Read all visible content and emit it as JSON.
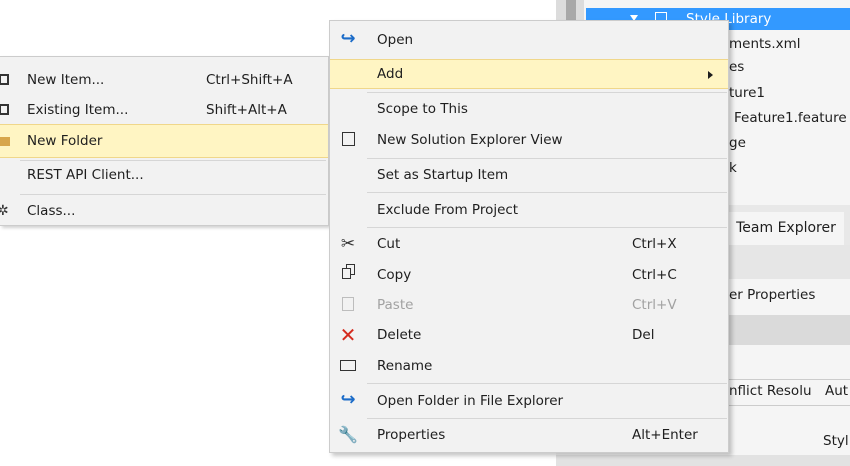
{
  "background": {
    "tree_items": [
      {
        "label": "Style Library",
        "selected": true
      },
      {
        "label": "ments.xml"
      },
      {
        "label": "es"
      },
      {
        "label": "ture1"
      },
      {
        "label": "Feature1.feature"
      },
      {
        "label": "ge"
      },
      {
        "label": "k"
      }
    ],
    "active_tab": "Team Explorer",
    "properties_title": "er Properties",
    "conflict_row_label": "nflict Resolu",
    "conflict_row_value": "Aut",
    "style_value": "Styl"
  },
  "submenu": {
    "items": [
      {
        "label": "New Item...",
        "shortcut": "Ctrl+Shift+A",
        "icon": "new-item-icon"
      },
      {
        "label": "Existing Item...",
        "shortcut": "Shift+Alt+A",
        "icon": "existing-item-icon"
      },
      {
        "label": "New Folder",
        "shortcut": "",
        "icon": "folder-icon",
        "highlighted": true
      },
      {
        "label": "REST API Client...",
        "shortcut": ""
      },
      {
        "label": "Class...",
        "shortcut": "",
        "icon": "class-icon"
      }
    ]
  },
  "context_menu": {
    "items": [
      {
        "label": "Open",
        "shortcut": "",
        "icon": "open-icon"
      },
      {
        "label": "Add",
        "shortcut": "",
        "highlighted": true,
        "has_submenu": true
      },
      {
        "label": "Scope to This",
        "shortcut": ""
      },
      {
        "label": "New Solution Explorer View",
        "shortcut": "",
        "icon": "solution-view-icon"
      },
      {
        "label": "Set as Startup Item",
        "shortcut": ""
      },
      {
        "label": "Exclude From Project",
        "shortcut": ""
      },
      {
        "label": "Cut",
        "shortcut": "Ctrl+X",
        "icon": "scissors-icon"
      },
      {
        "label": "Copy",
        "shortcut": "Ctrl+C",
        "icon": "copy-icon"
      },
      {
        "label": "Paste",
        "shortcut": "Ctrl+V",
        "icon": "paste-icon",
        "disabled": true
      },
      {
        "label": "Delete",
        "shortcut": "Del",
        "icon": "delete-icon"
      },
      {
        "label": "Rename",
        "shortcut": "",
        "icon": "rename-icon"
      },
      {
        "label": "Open Folder in File Explorer",
        "shortcut": "",
        "icon": "open-icon"
      },
      {
        "label": "Properties",
        "shortcut": "Alt+Enter",
        "icon": "wrench-icon"
      }
    ]
  },
  "colors": {
    "menu_bg": "#f2f2f2",
    "highlight_bg": "#fff5c3",
    "selection_blue": "#3399ff",
    "open_icon": "#1c6cc8",
    "delete_icon": "#d52b1e"
  }
}
